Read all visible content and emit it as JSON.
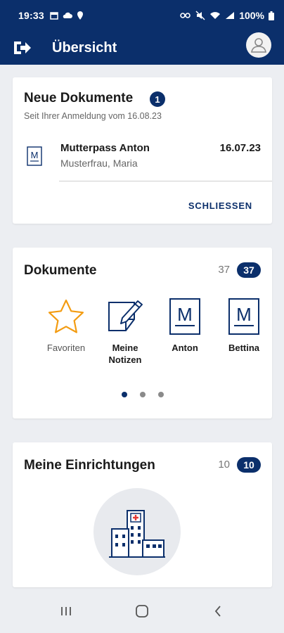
{
  "status_bar": {
    "time": "19:33",
    "battery": "100%"
  },
  "app_bar": {
    "title": "Übersicht"
  },
  "new_documents": {
    "title": "Neue Dokumente",
    "badge": "1",
    "subtitle": "Seit Ihrer Anmeldung vom 16.08.23",
    "items": [
      {
        "icon_letter": "M",
        "name": "Mutterpass Anton",
        "date": "16.07.23",
        "subtitle": "Musterfrau, Maria"
      }
    ],
    "close_label": "SCHLIESSEN"
  },
  "documents": {
    "title": "Dokumente",
    "count": "37",
    "badge": "37",
    "tiles": [
      {
        "label": "Favoriten",
        "icon": "star-icon"
      },
      {
        "label": "Meine\nNotizen",
        "icon": "notes-icon"
      },
      {
        "label": "Anton",
        "icon": "document-m-icon",
        "letter": "M"
      },
      {
        "label": "Bettina",
        "icon": "document-m-icon",
        "letter": "M"
      }
    ],
    "pages": 3,
    "active_page": 1
  },
  "facilities": {
    "title": "Meine Einrichtungen",
    "count": "10",
    "badge": "10"
  },
  "colors": {
    "primary": "#0b2f6b",
    "accent_star": "#f39c12",
    "hospital_cross": "#e53935"
  }
}
